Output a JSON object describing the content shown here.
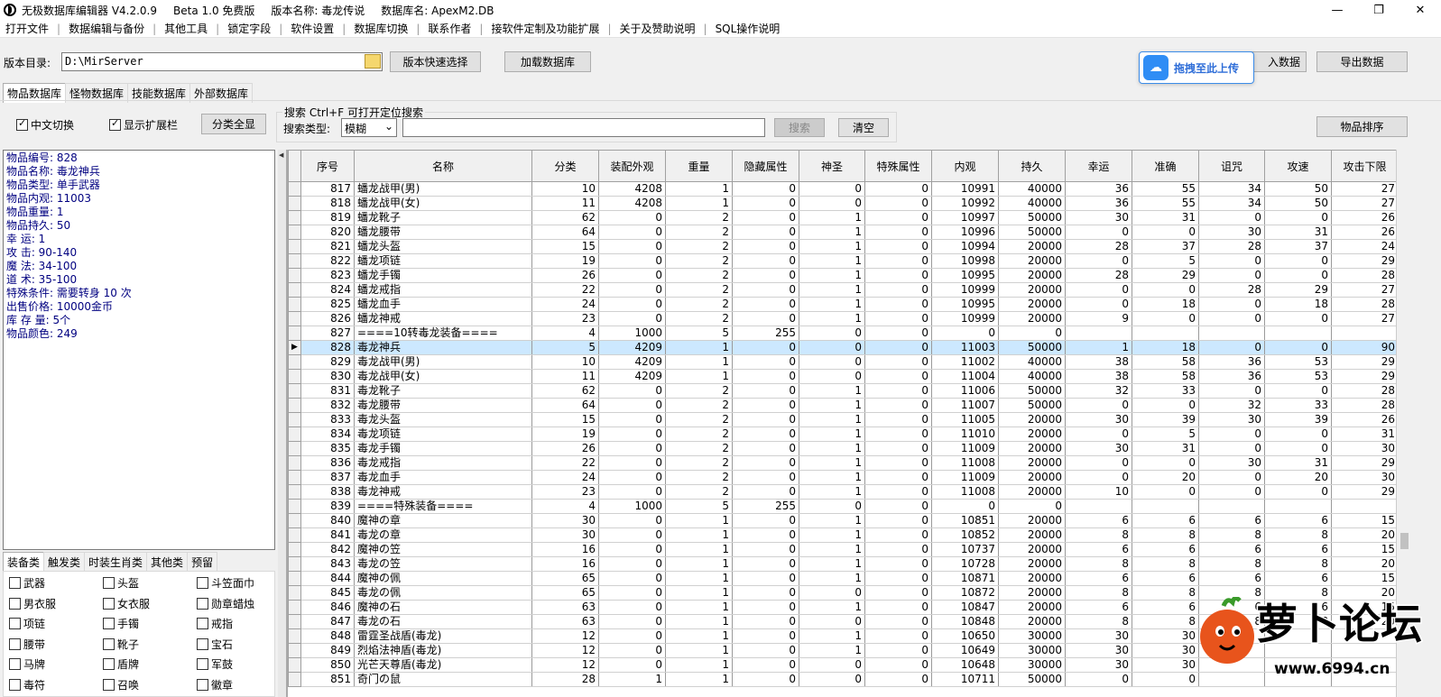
{
  "title": {
    "app": "无极数据库编辑器 V4.2.0.9",
    "edition": "Beta 1.0 免费版",
    "version_label": "版本名称: 毒龙传说",
    "db_label": "数据库名: ApexM2.DB"
  },
  "window_controls": {
    "minimize": "—",
    "maximize": "❐",
    "close": "✕"
  },
  "menu": [
    "打开文件",
    "数据编辑与备份",
    "其他工具",
    "锁定字段",
    "软件设置",
    "数据库切换",
    "联系作者",
    "接软件定制及功能扩展",
    "关于及赞助说明",
    "SQL操作说明"
  ],
  "path": {
    "label": "版本目录:",
    "value": "D:\\MirServer",
    "quick_select": "版本快速选择",
    "load_db": "加载数据库",
    "import_btn_partial": "入数据",
    "export": "导出数据"
  },
  "upload_badge": {
    "text": "拖拽至此上传"
  },
  "db_tabs": [
    "物品数据库",
    "怪物数据库",
    "技能数据库",
    "外部数据库"
  ],
  "options": {
    "chinese": "中文切换",
    "show_ext": "显示扩展栏",
    "show_all": "分类全显"
  },
  "search": {
    "title": "搜索 Ctrl+F 可打开定位搜索",
    "type_label": "搜索类型:",
    "type_value": "模糊",
    "query": "",
    "search_btn": "搜索",
    "clear_btn": "清空"
  },
  "sort_btn": "物品排序",
  "info": [
    "物品编号: 828",
    "物品名称: 毒龙神兵",
    "物品类型: 单手武器",
    "物品内观: 11003",
    "物品重量: 1",
    "物品持久: 50",
    "幸    运: 1",
    "攻    击: 90-140",
    "魔    法: 34-100",
    "道    术: 35-100",
    "特殊条件: 需要转身 10 次",
    "出售价格: 10000金币",
    "库 存 量: 5个",
    "物品颜色: 249"
  ],
  "category_tabs": [
    "装备类",
    "触发类",
    "时装生肖类",
    "其他类",
    "预留"
  ],
  "categories": [
    "武器",
    "头盔",
    "斗笠面巾",
    "男衣服",
    "女衣服",
    "勋章蜡烛",
    "项链",
    "手镯",
    "戒指",
    "腰带",
    "靴子",
    "宝石",
    "马牌",
    "盾牌",
    "军鼓",
    "毒符",
    "召唤",
    "徽章"
  ],
  "columns": [
    "序号",
    "名称",
    "分类",
    "装配外观",
    "重量",
    "隐藏属性",
    "神圣",
    "特殊属性",
    "内观",
    "持久",
    "幸运",
    "准确",
    "诅咒",
    "攻速",
    "攻击下限"
  ],
  "rows": [
    [
      "817",
      "蟠龙战甲(男)",
      "10",
      "4208",
      "1",
      "0",
      "0",
      "0",
      "10991",
      "40000",
      "36",
      "55",
      "34",
      "50",
      "27"
    ],
    [
      "818",
      "蟠龙战甲(女)",
      "11",
      "4208",
      "1",
      "0",
      "0",
      "0",
      "10992",
      "40000",
      "36",
      "55",
      "34",
      "50",
      "27"
    ],
    [
      "819",
      "蟠龙靴子",
      "62",
      "0",
      "2",
      "0",
      "1",
      "0",
      "10997",
      "50000",
      "30",
      "31",
      "0",
      "0",
      "26"
    ],
    [
      "820",
      "蟠龙腰带",
      "64",
      "0",
      "2",
      "0",
      "1",
      "0",
      "10996",
      "50000",
      "0",
      "0",
      "30",
      "31",
      "26"
    ],
    [
      "821",
      "蟠龙头盔",
      "15",
      "0",
      "2",
      "0",
      "1",
      "0",
      "10994",
      "20000",
      "28",
      "37",
      "28",
      "37",
      "24"
    ],
    [
      "822",
      "蟠龙项链",
      "19",
      "0",
      "2",
      "0",
      "1",
      "0",
      "10998",
      "20000",
      "0",
      "5",
      "0",
      "0",
      "29"
    ],
    [
      "823",
      "蟠龙手镯",
      "26",
      "0",
      "2",
      "0",
      "1",
      "0",
      "10995",
      "20000",
      "28",
      "29",
      "0",
      "0",
      "28"
    ],
    [
      "824",
      "蟠龙戒指",
      "22",
      "0",
      "2",
      "0",
      "1",
      "0",
      "10999",
      "20000",
      "0",
      "0",
      "28",
      "29",
      "27"
    ],
    [
      "825",
      "蟠龙血手",
      "24",
      "0",
      "2",
      "0",
      "1",
      "0",
      "10995",
      "20000",
      "0",
      "18",
      "0",
      "18",
      "28"
    ],
    [
      "826",
      "蟠龙神戒",
      "23",
      "0",
      "2",
      "0",
      "1",
      "0",
      "10999",
      "20000",
      "9",
      "0",
      "0",
      "0",
      "27"
    ],
    [
      "827",
      "====10转毒龙装备====",
      "4",
      "1000",
      "5",
      "255",
      "0",
      "0",
      "0",
      "0",
      "",
      "",
      "",
      "",
      ""
    ],
    [
      "828",
      "毒龙神兵",
      "5",
      "4209",
      "1",
      "0",
      "0",
      "0",
      "11003",
      "50000",
      "1",
      "18",
      "0",
      "0",
      "90"
    ],
    [
      "829",
      "毒龙战甲(男)",
      "10",
      "4209",
      "1",
      "0",
      "0",
      "0",
      "11002",
      "40000",
      "38",
      "58",
      "36",
      "53",
      "29"
    ],
    [
      "830",
      "毒龙战甲(女)",
      "11",
      "4209",
      "1",
      "0",
      "0",
      "0",
      "11004",
      "40000",
      "38",
      "58",
      "36",
      "53",
      "29"
    ],
    [
      "831",
      "毒龙靴子",
      "62",
      "0",
      "2",
      "0",
      "1",
      "0",
      "11006",
      "50000",
      "32",
      "33",
      "0",
      "0",
      "28"
    ],
    [
      "832",
      "毒龙腰带",
      "64",
      "0",
      "2",
      "0",
      "1",
      "0",
      "11007",
      "50000",
      "0",
      "0",
      "32",
      "33",
      "28"
    ],
    [
      "833",
      "毒龙头盔",
      "15",
      "0",
      "2",
      "0",
      "1",
      "0",
      "11005",
      "20000",
      "30",
      "39",
      "30",
      "39",
      "26"
    ],
    [
      "834",
      "毒龙项链",
      "19",
      "0",
      "2",
      "0",
      "1",
      "0",
      "11010",
      "20000",
      "0",
      "5",
      "0",
      "0",
      "31"
    ],
    [
      "835",
      "毒龙手镯",
      "26",
      "0",
      "2",
      "0",
      "1",
      "0",
      "11009",
      "20000",
      "30",
      "31",
      "0",
      "0",
      "30"
    ],
    [
      "836",
      "毒龙戒指",
      "22",
      "0",
      "2",
      "0",
      "1",
      "0",
      "11008",
      "20000",
      "0",
      "0",
      "30",
      "31",
      "29"
    ],
    [
      "837",
      "毒龙血手",
      "24",
      "0",
      "2",
      "0",
      "1",
      "0",
      "11009",
      "20000",
      "0",
      "20",
      "0",
      "20",
      "30"
    ],
    [
      "838",
      "毒龙神戒",
      "23",
      "0",
      "2",
      "0",
      "1",
      "0",
      "11008",
      "20000",
      "10",
      "0",
      "0",
      "0",
      "29"
    ],
    [
      "839",
      "====特殊装备====",
      "4",
      "1000",
      "5",
      "255",
      "0",
      "0",
      "0",
      "0",
      "",
      "",
      "",
      "",
      ""
    ],
    [
      "840",
      "魔神の章",
      "30",
      "0",
      "1",
      "0",
      "1",
      "0",
      "10851",
      "20000",
      "6",
      "6",
      "6",
      "6",
      "15"
    ],
    [
      "841",
      "毒龙の章",
      "30",
      "0",
      "1",
      "0",
      "1",
      "0",
      "10852",
      "20000",
      "8",
      "8",
      "8",
      "8",
      "20"
    ],
    [
      "842",
      "魔神の笠",
      "16",
      "0",
      "1",
      "0",
      "1",
      "0",
      "10737",
      "20000",
      "6",
      "6",
      "6",
      "6",
      "15"
    ],
    [
      "843",
      "毒龙の笠",
      "16",
      "0",
      "1",
      "0",
      "1",
      "0",
      "10728",
      "20000",
      "8",
      "8",
      "8",
      "8",
      "20"
    ],
    [
      "844",
      "魔神の佩",
      "65",
      "0",
      "1",
      "0",
      "1",
      "0",
      "10871",
      "20000",
      "6",
      "6",
      "6",
      "6",
      "15"
    ],
    [
      "845",
      "毒龙の佩",
      "65",
      "0",
      "1",
      "0",
      "0",
      "0",
      "10872",
      "20000",
      "8",
      "8",
      "8",
      "8",
      "20"
    ],
    [
      "846",
      "魔神の石",
      "63",
      "0",
      "1",
      "0",
      "1",
      "0",
      "10847",
      "20000",
      "6",
      "6",
      "6",
      "6",
      "15"
    ],
    [
      "847",
      "毒龙の石",
      "63",
      "0",
      "1",
      "0",
      "0",
      "0",
      "10848",
      "20000",
      "8",
      "8",
      "8",
      "8",
      "20"
    ],
    [
      "848",
      "雷霆圣战盾(毒龙)",
      "12",
      "0",
      "1",
      "0",
      "1",
      "0",
      "10650",
      "30000",
      "30",
      "30",
      "",
      "",
      ""
    ],
    [
      "849",
      "烈焰法神盾(毒龙)",
      "12",
      "0",
      "1",
      "0",
      "1",
      "0",
      "10649",
      "30000",
      "30",
      "30",
      "",
      "",
      ""
    ],
    [
      "850",
      "光芒天尊盾(毒龙)",
      "12",
      "0",
      "1",
      "0",
      "0",
      "0",
      "10648",
      "30000",
      "30",
      "30",
      "",
      "",
      ""
    ],
    [
      "851",
      "奇门の鼠",
      "28",
      "1",
      "1",
      "0",
      "0",
      "0",
      "10711",
      "50000",
      "0",
      "0",
      "",
      "",
      ""
    ]
  ],
  "selected_row": "828",
  "watermark": {
    "brand": "萝卜论坛",
    "url": "www.6994.cn"
  }
}
